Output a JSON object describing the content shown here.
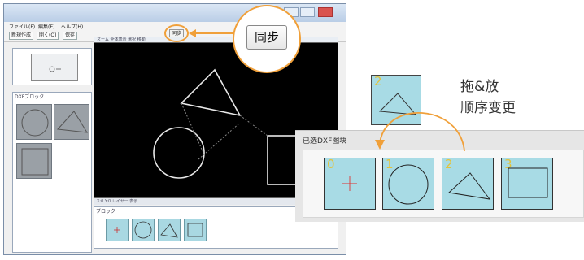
{
  "app_window": {
    "menus": [
      "ファイル(F)",
      "編集(E)",
      "ヘルプ(H)"
    ],
    "toolbar": [
      "新規作成",
      "開く(O)",
      "保存"
    ],
    "layers_panel_title": "DXFブロック",
    "canvas_toolbar": "ズーム  全体表示  選択  移動",
    "status_bar": "X:0  Y:0  レイヤー  表示",
    "bottom_panel_title": "ブロック"
  },
  "sync": {
    "small_label": "同步",
    "button_label": "同步"
  },
  "drag_drop": {
    "tile_number": "2",
    "label_line1": "拖&放",
    "label_line2": "顺序变更"
  },
  "dxf_panel": {
    "title": "已选DXF图块",
    "tiles": [
      {
        "number": "0",
        "shape": "cross"
      },
      {
        "number": "1",
        "shape": "circle"
      },
      {
        "number": "2",
        "shape": "triangle"
      },
      {
        "number": "3",
        "shape": "rectangle"
      }
    ]
  },
  "colors": {
    "accent": "#f0a03a",
    "tile_fill": "#a8dbe5",
    "tile_number": "#e3c33a",
    "canvas_bg": "#000000"
  }
}
